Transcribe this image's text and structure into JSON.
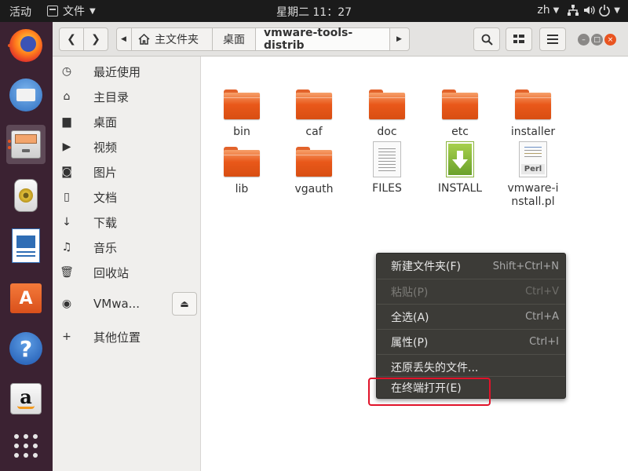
{
  "topbar": {
    "activities": "活动",
    "app_name": "文件",
    "clock": "星期二 11：27",
    "input_method": "zh"
  },
  "dock": {
    "items": [
      "firefox",
      "thunderbird",
      "files",
      "rhythmbox",
      "libreoffice-writer",
      "software-center",
      "help",
      "amazon",
      "show-apps"
    ]
  },
  "headerbar": {
    "breadcrumbs": [
      "主文件夹",
      "桌面",
      "vmware-tools-distrib"
    ]
  },
  "sidebar": {
    "items": [
      {
        "label": "最近使用",
        "icon": "clock-icon"
      },
      {
        "label": "主目录",
        "icon": "home-icon"
      },
      {
        "label": "桌面",
        "icon": "folder-icon"
      },
      {
        "label": "视频",
        "icon": "video-icon"
      },
      {
        "label": "图片",
        "icon": "camera-icon"
      },
      {
        "label": "文档",
        "icon": "document-icon"
      },
      {
        "label": "下载",
        "icon": "download-icon"
      },
      {
        "label": "音乐",
        "icon": "music-icon"
      },
      {
        "label": "回收站",
        "icon": "trash-icon"
      },
      {
        "label": "VMwa...",
        "icon": "disc-icon"
      },
      {
        "label": "其他位置",
        "icon": "plus-icon"
      }
    ]
  },
  "files": [
    {
      "name": "bin",
      "type": "folder"
    },
    {
      "name": "caf",
      "type": "folder"
    },
    {
      "name": "doc",
      "type": "folder"
    },
    {
      "name": "etc",
      "type": "folder"
    },
    {
      "name": "installer",
      "type": "folder"
    },
    {
      "name": "lib",
      "type": "folder"
    },
    {
      "name": "vgauth",
      "type": "folder"
    },
    {
      "name": "FILES",
      "type": "text"
    },
    {
      "name": "INSTALL",
      "type": "install"
    },
    {
      "name": "vmware-install.pl",
      "type": "perl",
      "badge": "Perl"
    }
  ],
  "context_menu": {
    "items": [
      {
        "label": "新建文件夹(F)",
        "accel": "Shift+Ctrl+N",
        "enabled": true
      },
      {
        "label": "粘贴(P)",
        "accel": "Ctrl+V",
        "enabled": false
      },
      {
        "label": "全选(A)",
        "accel": "Ctrl+A",
        "enabled": true
      },
      {
        "label": "属性(P)",
        "accel": "Ctrl+I",
        "enabled": true
      },
      {
        "label": "还原丢失的文件...",
        "accel": "",
        "enabled": true
      },
      {
        "label": "在终端打开(E)",
        "accel": "",
        "enabled": true
      }
    ],
    "highlight_color": "#e0132a"
  }
}
